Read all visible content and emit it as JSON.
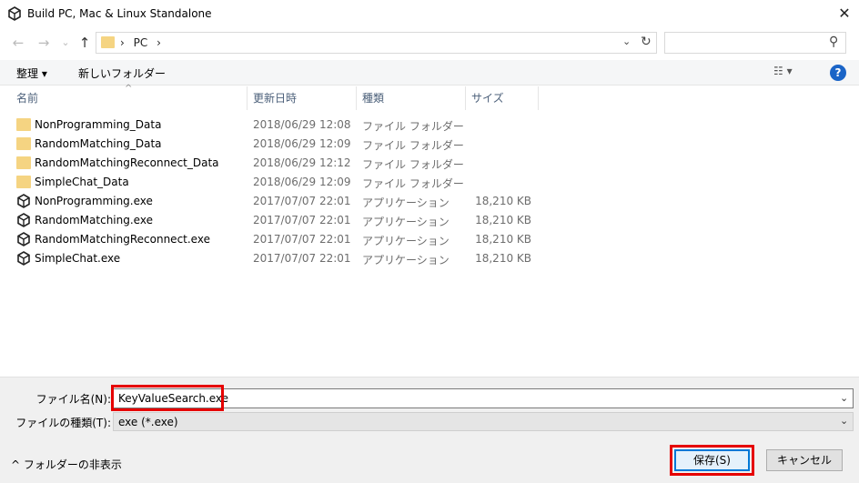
{
  "window": {
    "title": "Build PC, Mac & Linux Standalone",
    "logo_icon": "unity-logo-icon",
    "close_label": "✕"
  },
  "nav": {
    "back": "←",
    "forward": "→",
    "recent": "⌄",
    "up": "↑"
  },
  "address": {
    "path": "PC",
    "dropdown": "⌄",
    "refresh": "↻"
  },
  "search": {
    "placeholder": "",
    "icon": "⚲"
  },
  "toolbar": {
    "organize_label": "整理 ▾",
    "new_folder_label": "新しいフォルダー",
    "view_label": "☷ ▾",
    "help_label": "?"
  },
  "columns": {
    "name": "名前",
    "modified": "更新日時",
    "type": "種類",
    "size": "サイズ",
    "sort_indicator": "^"
  },
  "files": [
    {
      "name": "NonProgramming_Data",
      "modified": "2018/06/29 12:08",
      "type": "ファイル フォルダー",
      "size": "",
      "kind": "folder"
    },
    {
      "name": "RandomMatching_Data",
      "modified": "2018/06/29 12:09",
      "type": "ファイル フォルダー",
      "size": "",
      "kind": "folder"
    },
    {
      "name": "RandomMatchingReconnect_Data",
      "modified": "2018/06/29 12:12",
      "type": "ファイル フォルダー",
      "size": "",
      "kind": "folder"
    },
    {
      "name": "SimpleChat_Data",
      "modified": "2018/06/29 12:09",
      "type": "ファイル フォルダー",
      "size": "",
      "kind": "folder"
    },
    {
      "name": "NonProgramming.exe",
      "modified": "2017/07/07 22:01",
      "type": "アプリケーション",
      "size": "18,210 KB",
      "kind": "exe"
    },
    {
      "name": "RandomMatching.exe",
      "modified": "2017/07/07 22:01",
      "type": "アプリケーション",
      "size": "18,210 KB",
      "kind": "exe"
    },
    {
      "name": "RandomMatchingReconnect.exe",
      "modified": "2017/07/07 22:01",
      "type": "アプリケーション",
      "size": "18,210 KB",
      "kind": "exe"
    },
    {
      "name": "SimpleChat.exe",
      "modified": "2017/07/07 22:01",
      "type": "アプリケーション",
      "size": "18,210 KB",
      "kind": "exe"
    }
  ],
  "form": {
    "filename_label": "ファイル名(N):",
    "filename_value": "KeyValueSearch.exe",
    "filetype_label": "ファイルの種類(T):",
    "filetype_value": "exe (*.exe)",
    "dropdown": "⌄",
    "toggle_folders_label": "^ フォルダーの非表示",
    "save_label": "保存(S)",
    "cancel_label": "キャンセル"
  },
  "colors": {
    "highlight": "#e60000",
    "accent": "#0078d7",
    "folder": "#f5d482"
  }
}
